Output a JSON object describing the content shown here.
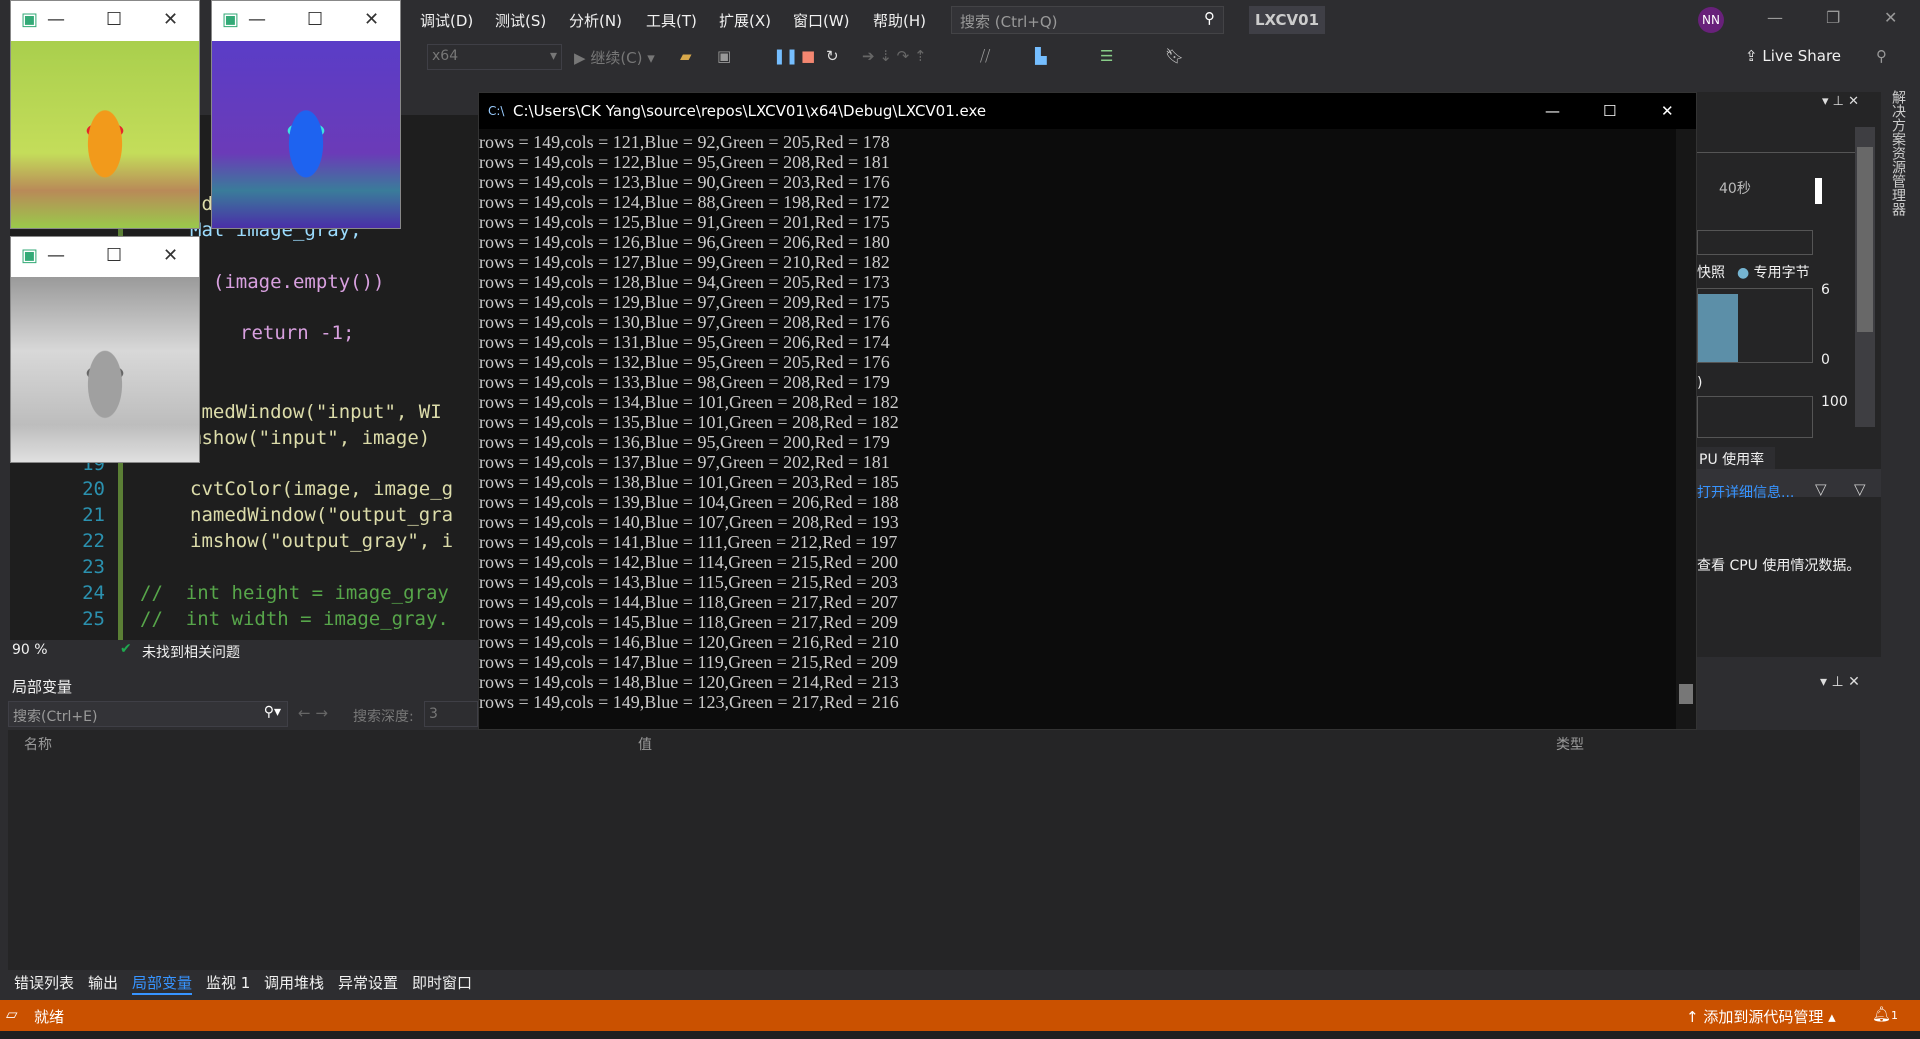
{
  "menu": {
    "items": [
      "调试(D)",
      "测试(S)",
      "分析(N)",
      "工具(T)",
      "扩展(X)",
      "窗口(W)",
      "帮助(H)"
    ],
    "search_placeholder": "搜索 (Ctrl+Q)",
    "project": "LXCV01",
    "avatar": "NN"
  },
  "toolbar": {
    "platform": "x64",
    "continue": "继续(C)",
    "live_share": "Live Share"
  },
  "editor": {
    "lines": [
      {
        "n": "",
        "t": "a"
      },
      {
        "n": "",
        "t": "ad(\"C:/"
      },
      {
        "n": "",
        "t": "Mat image_gray;"
      },
      {
        "n": "",
        "t": "f (image.empty())"
      },
      {
        "n": "",
        "t": "return -1;"
      },
      {
        "n": "",
        "t": "amedWindow(\"input\", WI"
      },
      {
        "n": "",
        "t": "mshow(\"input\", image)"
      },
      {
        "n": "19",
        "t": ""
      },
      {
        "n": "20",
        "t": "cvtColor(image, image_g"
      },
      {
        "n": "21",
        "t": "namedWindow(\"output_gra"
      },
      {
        "n": "22",
        "t": "imshow(\"output_gray\", i"
      },
      {
        "n": "23",
        "t": ""
      },
      {
        "n": "24",
        "t": "//  int height = image_gray"
      },
      {
        "n": "25",
        "t": "//  int width = image_gray."
      }
    ],
    "zoom": "90 %",
    "issues": "未找到相关问题"
  },
  "console": {
    "title": "C:\\Users\\CK Yang\\source\\repos\\LXCV01\\x64\\Debug\\LXCV01.exe",
    "lines": [
      "rows = 149,cols = 121,Blue = 92,Green = 205,Red = 178",
      "rows = 149,cols = 122,Blue = 95,Green = 208,Red = 181",
      "rows = 149,cols = 123,Blue = 90,Green = 203,Red = 176",
      "rows = 149,cols = 124,Blue = 88,Green = 198,Red = 172",
      "rows = 149,cols = 125,Blue = 91,Green = 201,Red = 175",
      "rows = 149,cols = 126,Blue = 96,Green = 206,Red = 180",
      "rows = 149,cols = 127,Blue = 99,Green = 210,Red = 182",
      "rows = 149,cols = 128,Blue = 94,Green = 205,Red = 173",
      "rows = 149,cols = 129,Blue = 97,Green = 209,Red = 175",
      "rows = 149,cols = 130,Blue = 97,Green = 208,Red = 176",
      "rows = 149,cols = 131,Blue = 95,Green = 206,Red = 174",
      "rows = 149,cols = 132,Blue = 95,Green = 205,Red = 176",
      "rows = 149,cols = 133,Blue = 98,Green = 208,Red = 179",
      "rows = 149,cols = 134,Blue = 101,Green = 208,Red = 182",
      "rows = 149,cols = 135,Blue = 101,Green = 208,Red = 182",
      "rows = 149,cols = 136,Blue = 95,Green = 200,Red = 179",
      "rows = 149,cols = 137,Blue = 97,Green = 202,Red = 181",
      "rows = 149,cols = 138,Blue = 101,Green = 203,Red = 185",
      "rows = 149,cols = 139,Blue = 104,Green = 206,Red = 188",
      "rows = 149,cols = 140,Blue = 107,Green = 208,Red = 193",
      "rows = 149,cols = 141,Blue = 111,Green = 212,Red = 197",
      "rows = 149,cols = 142,Blue = 114,Green = 215,Red = 200",
      "rows = 149,cols = 143,Blue = 115,Green = 215,Red = 203",
      "rows = 149,cols = 144,Blue = 118,Green = 217,Red = 207",
      "rows = 149,cols = 145,Blue = 118,Green = 217,Red = 209",
      "rows = 149,cols = 146,Blue = 120,Green = 216,Red = 210",
      "rows = 149,cols = 147,Blue = 119,Green = 215,Red = 209",
      "rows = 149,cols = 148,Blue = 120,Green = 214,Red = 213",
      "rows = 149,cols = 149,Blue = 123,Green = 217,Red = 216"
    ]
  },
  "diag": {
    "time": "40秒",
    "legend": "快照",
    "legend2": "专用字节",
    "y_max": "6",
    "y_min": "0",
    "cpu_max": "100",
    "paren": ")",
    "cpu_tab": "PU 使用率",
    "open_details": "打开详细信息...",
    "cpu_msg": "查看 CPU 使用情况数据。",
    "vertical_tab": "解决方案资源管理器"
  },
  "locals": {
    "title": "局部变量",
    "search_placeholder": "搜索(Ctrl+E)",
    "depth_label": "搜索深度:",
    "depth": "3",
    "col_name": "名称",
    "col_value": "值",
    "col_type": "类型"
  },
  "bottom_tabs": [
    "错误列表",
    "输出",
    "局部变量",
    "监视 1",
    "调用堆栈",
    "异常设置",
    "即时窗口"
  ],
  "status": {
    "ready": "就绪",
    "source_control": "添加到源代码管理",
    "notifications": "1"
  },
  "colors": {
    "status_bar": "#ca5100",
    "accent": "#007acc"
  }
}
